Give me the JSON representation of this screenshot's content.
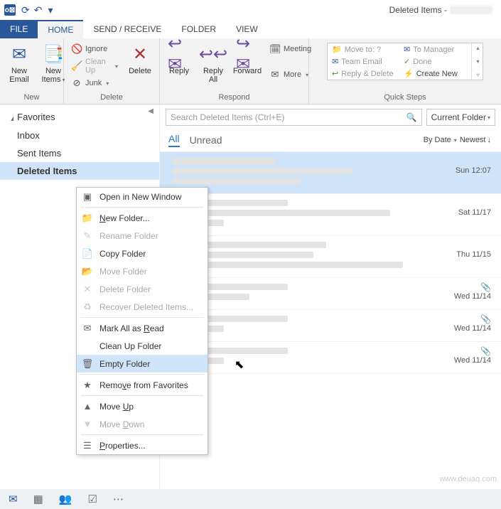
{
  "title": "Deleted Items -",
  "tabs": {
    "file": "FILE",
    "home": "HOME",
    "sendrecv": "SEND / RECEIVE",
    "folder": "FOLDER",
    "view": "VIEW"
  },
  "ribbon": {
    "new": {
      "new_email": "New\nEmail",
      "new_items": "New\nItems",
      "label": "New"
    },
    "delete": {
      "ignore": "Ignore",
      "cleanup": "Clean Up",
      "junk": "Junk",
      "delete": "Delete",
      "label": "Delete"
    },
    "respond": {
      "reply": "Reply",
      "reply_all": "Reply\nAll",
      "forward": "Forward",
      "meeting": "Meeting",
      "more": "More",
      "label": "Respond"
    },
    "quicksteps": {
      "label": "Quick Steps",
      "items": [
        "Move to: ?",
        "Team Email",
        "Reply & Delete",
        "To Manager",
        "Done",
        "Create New"
      ]
    }
  },
  "nav": {
    "favorites": "Favorites",
    "items": [
      "Inbox",
      "Sent Items",
      "Deleted Items"
    ]
  },
  "search": {
    "placeholder": "Search Deleted Items (Ctrl+E)",
    "scope": "Current Folder"
  },
  "filters": {
    "all": "All",
    "unread": "Unread",
    "by": "By Date",
    "order": "Newest"
  },
  "messages": [
    {
      "date": "Sun 12:07",
      "attach": false
    },
    {
      "date": "Sat 11/17",
      "attach": false
    },
    {
      "date": "Thu 11/15",
      "attach": false
    },
    {
      "date": "Wed 11/14",
      "attach": true
    },
    {
      "date": "Wed 11/14",
      "attach": true
    },
    {
      "date": "Wed 11/14",
      "attach": true
    }
  ],
  "ctx": {
    "open": "Open in New Window",
    "new_folder": "New Folder...",
    "rename": "Rename Folder",
    "copy": "Copy Folder",
    "move": "Move Folder",
    "delete": "Delete Folder",
    "recover": "Recover Deleted Items...",
    "mark": "Mark All as Read",
    "cleanup": "Clean Up Folder",
    "empty": "Empty Folder",
    "remove_fav": "Remove from Favorites",
    "move_up": "Move Up",
    "move_down": "Move Down",
    "props": "Properties..."
  },
  "watermark": "www.deuaq.com"
}
